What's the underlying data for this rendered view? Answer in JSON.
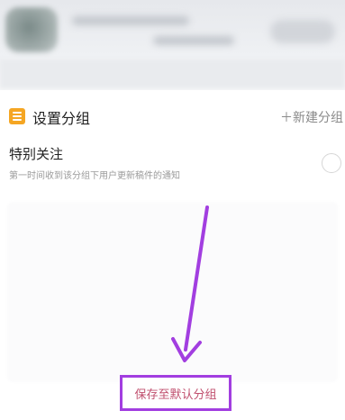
{
  "group_header": {
    "title": "设置分组",
    "new_group_label": "＋新建分组"
  },
  "special_group": {
    "title": "特别关注",
    "description": "第一时间收到该分组下用户更新稿件的通知",
    "selected": false
  },
  "save_button": {
    "label": "保存至默认分组"
  },
  "colors": {
    "accent_icon": "#f5a623",
    "highlight_box": "#a23ee0",
    "arrow": "#a23ee0",
    "save_text": "#c04f6e"
  },
  "icons": {
    "group_icon": "list-icon",
    "arrow": "arrow-down-icon"
  }
}
